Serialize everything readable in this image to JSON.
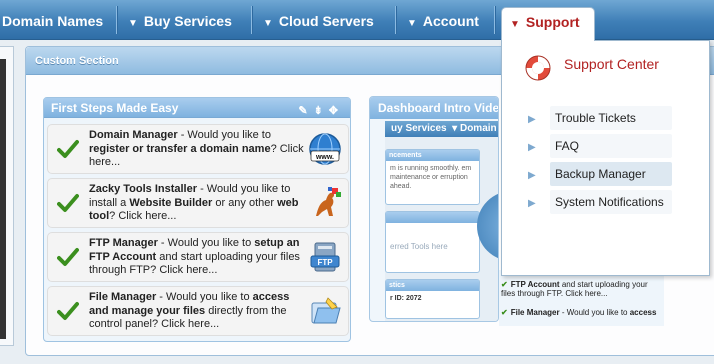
{
  "nav": {
    "domain_names": "Domain Names",
    "buy_services": "Buy Services",
    "cloud_servers": "Cloud Servers",
    "account": "Account",
    "support": "Support"
  },
  "custom_section": {
    "title": "Custom Section"
  },
  "first_steps": {
    "title": "First Steps Made Easy",
    "items": [
      {
        "name": "Domain Manager",
        "pre": " - Would you like to ",
        "bold": "register or transfer a domain name",
        "post": "? Click here...",
        "icon": "www-globe-icon"
      },
      {
        "name": "Zacky Tools Installer",
        "pre": " - Would you like to install a ",
        "bold": "Website Builder",
        "mid": " or any other ",
        "bold2": "web tool",
        "post": "? Click here...",
        "icon": "kangaroo-icon"
      },
      {
        "name": "FTP Manager",
        "pre": " - Would you like to ",
        "bold": "setup an FTP Account",
        "post": " and start uploading your files through FTP? Click here...",
        "icon": "ftp-server-icon"
      },
      {
        "name": "File Manager",
        "pre": " - Would you like to ",
        "bold": "access and manage your files",
        "post": " directly from the control panel? Click here...",
        "icon": "file-manager-icon"
      }
    ]
  },
  "video": {
    "title": "Dashboard Intro Video",
    "mini_nav": "uy Services",
    "mini_nav2": "Domain",
    "mini_panel1_title": "ncements",
    "mini_panel1_text": "m is running smoothly. em maintenance or erruption ahead.",
    "mini_panel2_text": "erred Tools here",
    "mini_panel3_title": "stics",
    "mini_panel3_text": "r ID: 2072"
  },
  "under_right": {
    "item1_bold": "FTP Account",
    "item1_rest": " and start uploading your files through FTP. Click here...",
    "item2_bold1": "File Manager",
    "item2_mid": " - Would you like to ",
    "item2_bold2": "access"
  },
  "support_menu": {
    "support_center": "Support Center",
    "items": [
      "Trouble Tickets",
      "FAQ",
      "Backup Manager",
      "System Notifications"
    ],
    "active_index": 2
  },
  "colors": {
    "nav_blue": "#3f7fb7",
    "support_red": "#b22222",
    "check_green": "#3b8f1e"
  }
}
